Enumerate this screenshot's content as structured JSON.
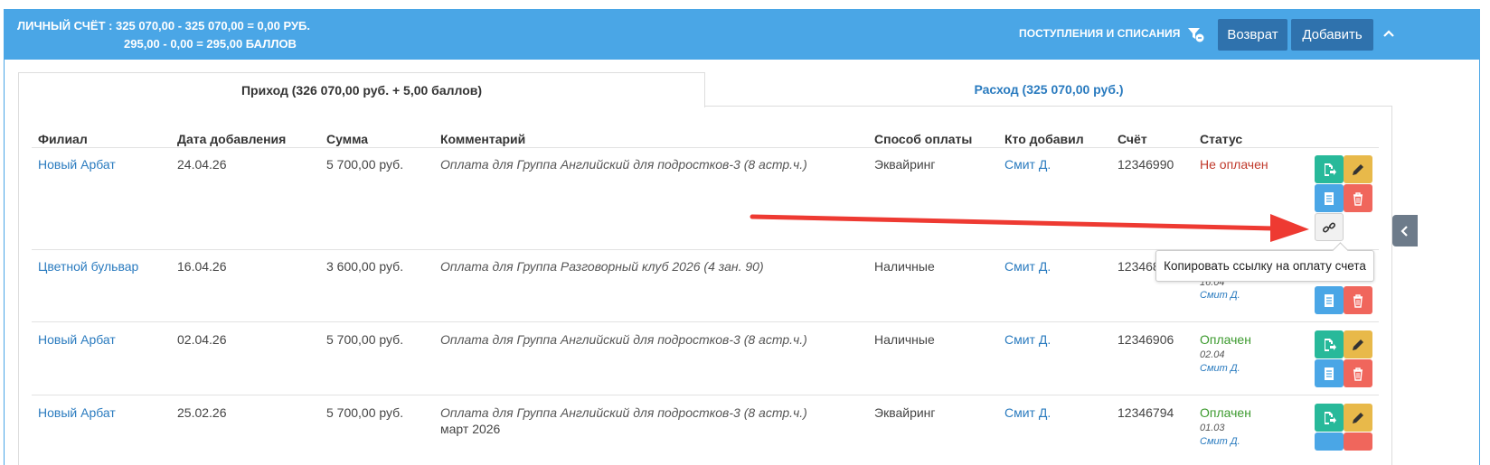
{
  "header": {
    "title_line1": "ЛИЧНЫЙ СЧЁТ : 325 070,00 - 325 070,00 = 0,00 РУБ.",
    "title_line2": "295,00 - 0,00 = 295,00 БАЛЛОВ",
    "income_expense_link": "ПОСТУПЛЕНИЯ И СПИСАНИЯ",
    "return_label": "Возврат",
    "add_label": "Добавить",
    "color": "#4aa6e6"
  },
  "tabs": [
    {
      "label": "Приход (326 070,00 руб. + 5,00 баллов)",
      "active": true
    },
    {
      "label": "Расход (325 070,00 руб.)",
      "active": false
    }
  ],
  "table": {
    "columns": [
      "Филиал",
      "Дата добавления",
      "Сумма",
      "Комментарий",
      "Способ оплаты",
      "Кто добавил",
      "Счёт",
      "Статус"
    ],
    "rows": [
      {
        "branch": "Новый Арбат",
        "date": "24.04.26",
        "amount": "5 700,00 руб.",
        "comment": "Оплата для Группа Английский для подростков-3 (8 астр.ч.)",
        "comment2": "",
        "method": "Эквайринг",
        "added_by": "Смит Д.",
        "invoice": "12346990",
        "status": "Не оплачен",
        "status_date": "",
        "status_by": ""
      },
      {
        "branch": "Цветной бульвар",
        "date": "16.04.26",
        "amount": "3 600,00 руб.",
        "comment": "Оплата для Группа Разговорный клуб 2026 (4 зан. 90)",
        "comment2": "",
        "method": "Наличные",
        "added_by": "Смит Д.",
        "invoice": "123468",
        "status": "",
        "status_date": "16.04",
        "status_by": "Смит Д."
      },
      {
        "branch": "Новый Арбат",
        "date": "02.04.26",
        "amount": "5 700,00 руб.",
        "comment": "Оплата для Группа Английский для подростков-3 (8 астр.ч.)",
        "comment2": "",
        "method": "Наличные",
        "added_by": "Смит Д.",
        "invoice": "12346906",
        "status": "Оплачен",
        "status_date": "02.04",
        "status_by": "Смит Д."
      },
      {
        "branch": "Новый Арбат",
        "date": "25.02.26",
        "amount": "5 700,00 руб.",
        "comment": "Оплата для Группа Английский для подростков-3 (8 астр.ч.)",
        "comment2": "март 2026",
        "method": "Эквайринг",
        "added_by": "Смит Д.",
        "invoice": "12346794",
        "status": "Оплачен",
        "status_date": "01.03",
        "status_by": "Смит Д."
      }
    ]
  },
  "tooltip": "Копировать ссылку на оплату счета",
  "colors": {
    "green": "#28b99a",
    "yellow": "#e8b94a",
    "blue": "#4aa6e6",
    "red": "#f0665c",
    "arrow": "#ee3a32",
    "unpaid": "#c0392b",
    "paid": "#3c9a2e"
  },
  "icons": [
    "filter-icon",
    "chevron-up-icon",
    "receipt-arrow-icon",
    "pencil-icon",
    "document-icon",
    "trash-icon",
    "link-icon",
    "chevron-left-icon"
  ]
}
